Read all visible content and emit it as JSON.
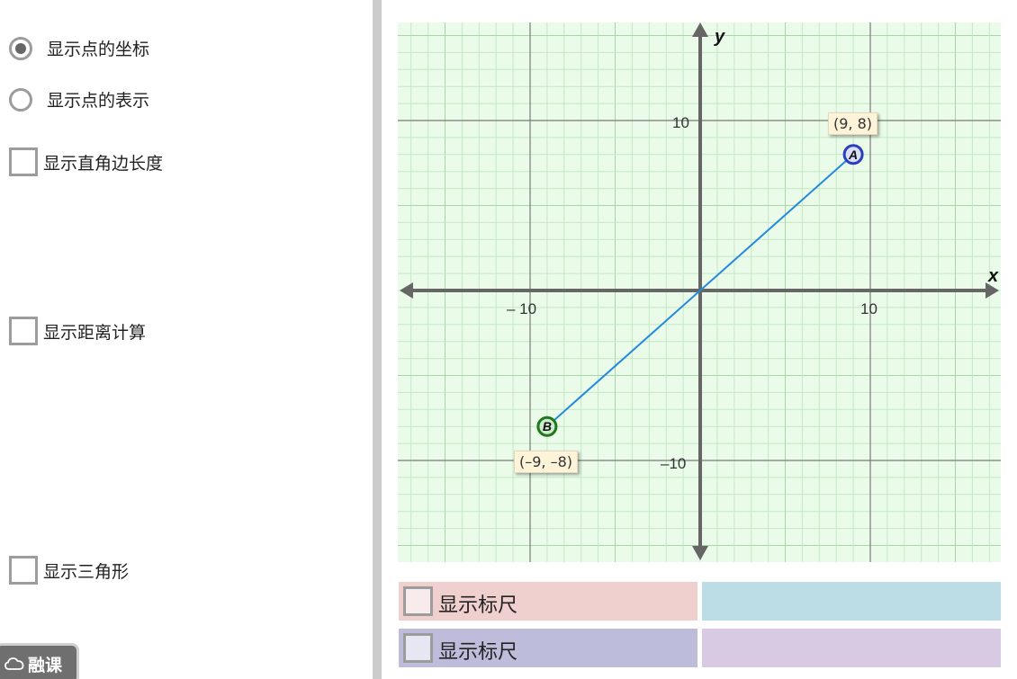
{
  "left_panel": {
    "radio_options": [
      {
        "label": "显示点的坐标",
        "selected": true
      },
      {
        "label": "显示点的表示",
        "selected": false
      }
    ],
    "checkboxes": {
      "leg_lengths": {
        "label": "显示直角边长度",
        "checked": false
      },
      "distance_calc": {
        "label": "显示距离计算",
        "checked": false
      },
      "triangle": {
        "label": "显示三角形",
        "checked": false
      }
    },
    "brand": {
      "text": "融课",
      "icon": "cloud-icon"
    }
  },
  "graph": {
    "x_axis_label": "x",
    "y_axis_label": "y",
    "x_ticks": [
      "– 10",
      "10"
    ],
    "y_ticks": [
      "10",
      "–10"
    ],
    "points": [
      {
        "name": "A",
        "x": 9,
        "y": 8,
        "coord_label": "(9, 8)",
        "color": "#2a3fbd"
      },
      {
        "name": "B",
        "x": -9,
        "y": -8,
        "coord_label": "(–9, –8)",
        "color": "#1c7a1c"
      }
    ],
    "segment_color": "#2289dd",
    "grid_background": "#eafbe9",
    "minor_grid_color": "#c5e8c5",
    "major_grid_color": "#7a7a7a"
  },
  "rulers": [
    {
      "label": "显示标尺",
      "left_color": "#f0d0cf",
      "right_color": "#bcdde6",
      "box_color": "#f7eceb"
    },
    {
      "label": "显示标尺",
      "left_color": "#bdbddb",
      "right_color": "#d8cae3",
      "box_color": "#e7e7f3"
    }
  ]
}
